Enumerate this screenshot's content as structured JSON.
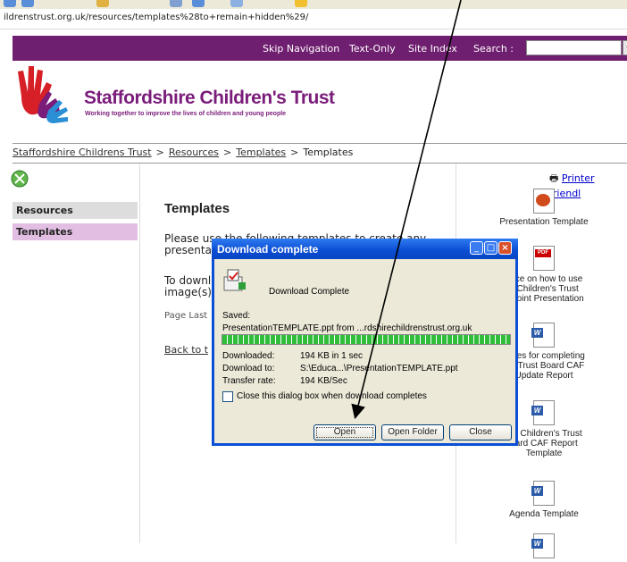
{
  "browser": {
    "address": "ildrenstrust.org.uk/resources/templates%28to+remain+hidden%29/"
  },
  "site_nav": {
    "skip": "Skip Navigation",
    "text_only": "Text-Only",
    "site_index": "Site Index",
    "search_label": "Search :",
    "search_go": "G",
    "search_value": ""
  },
  "header": {
    "org_name": "Staffordshire Children's Trust",
    "tagline": "Working together to improve the lives of children and young people"
  },
  "breadcrumb": [
    "Staffordshire Childrens Trust",
    "Resources",
    "Templates",
    "Templates"
  ],
  "breadcrumb_sep": ">",
  "sidebar": {
    "items": [
      {
        "label": "Resources"
      },
      {
        "label": "Templates"
      }
    ]
  },
  "main": {
    "title": "Templates",
    "p1_line1": "Please use the following templates to create any",
    "p1_line2": "presenta",
    "p2_line1": "To downl",
    "p2_line2": "image(s)",
    "updated": "Page Last",
    "back": "Back to t"
  },
  "right": {
    "printer": "Printer friendl",
    "docs": [
      {
        "icon": "ppt",
        "lines": [
          "Presentation Template"
        ]
      },
      {
        "icon": "pdf",
        "lines": [
          "ance on how to use",
          "e Children's Trust",
          "erpoint Presentation"
        ]
      },
      {
        "icon": "word",
        "lines": [
          "elines for completing",
          "rict Trust Board CAF",
          "Update Report"
        ]
      },
      {
        "icon": "word",
        "lines": [
          "rict Children's Trust",
          "oard CAF Report",
          "Template"
        ]
      },
      {
        "icon": "word",
        "lines": [
          "Agenda Template"
        ]
      }
    ]
  },
  "dialog": {
    "title": "Download complete",
    "heading": "Download Complete",
    "saved_label": "Saved:",
    "saved_value": "PresentationTEMPLATE.ppt from ...rdshirechildrenstrust.org.uk",
    "progress": 1.0,
    "downloaded_label": "Downloaded:",
    "downloaded_value": "194 KB in 1 sec",
    "download_to_label": "Download to:",
    "download_to_value": "S:\\Educa...\\PresentationTEMPLATE.ppt",
    "rate_label": "Transfer rate:",
    "rate_value": "194 KB/Sec",
    "checkbox_label": "Close this dialog box when download completes",
    "checkbox_checked": false,
    "open_label": "Open",
    "open_folder_label": "Open Folder",
    "close_label": "Close"
  }
}
